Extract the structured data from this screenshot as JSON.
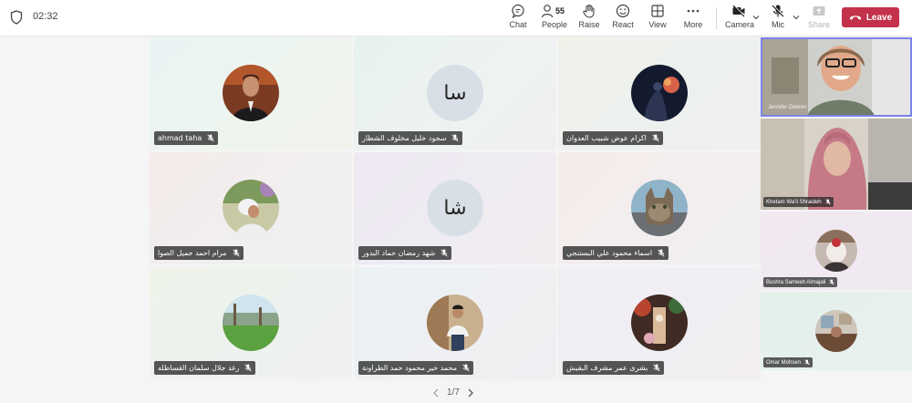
{
  "timer": "02:32",
  "toolbar": {
    "chat": "Chat",
    "people": "People",
    "people_count": "55",
    "raise": "Raise",
    "react": "React",
    "view": "View",
    "more": "More",
    "camera": "Camera",
    "mic": "Mic",
    "share": "Share",
    "leave": "Leave"
  },
  "tiles": [
    {
      "name": "ahmad taha",
      "initials": ""
    },
    {
      "name": "سجود خليل مخلوف الشطار",
      "initials": "سا"
    },
    {
      "name": "اكرام عوض شبيب العدوان",
      "initials": ""
    },
    {
      "name": "مرام احمد جميل الصوا",
      "initials": ""
    },
    {
      "name": "شهد رمضان حماد البدور",
      "initials": "شا"
    },
    {
      "name": "اسماء محمود علي البستنجي",
      "initials": ""
    },
    {
      "name": "رغد جلال سلمان القساطله",
      "initials": ""
    },
    {
      "name": "محمد خير محمود حمد الطراونة",
      "initials": ""
    },
    {
      "name": "بشرى عمر مشرف البقيش",
      "initials": ""
    }
  ],
  "side_tiles": [
    {
      "name": "Jennifer Deeren"
    },
    {
      "name": "Khetam Wa'il Shraideh"
    },
    {
      "name": "Bushra Sameeh Almajali"
    },
    {
      "name": "Omar Mohsen"
    }
  ],
  "pager": "1/7",
  "colors": {
    "leave": "#c4314b",
    "nametag": "#323232"
  }
}
